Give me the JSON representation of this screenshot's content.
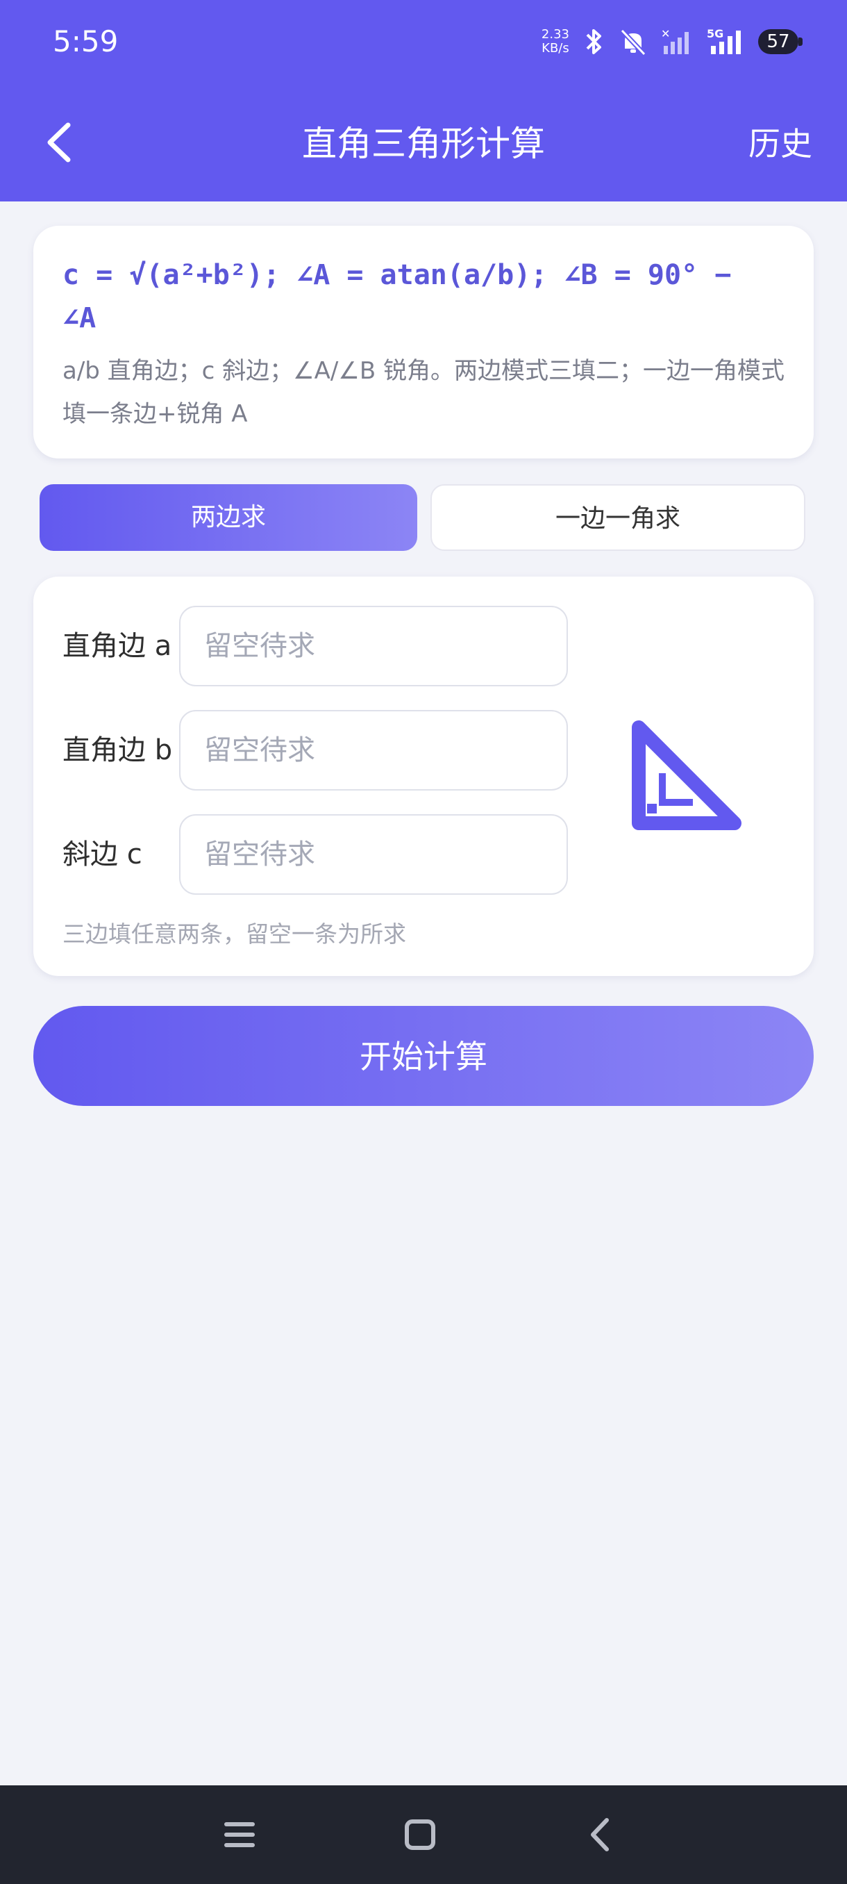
{
  "status_bar": {
    "time": "5:59",
    "net_speed_value": "2.33",
    "net_speed_unit": "KB/s",
    "network_label": "5G",
    "battery": "57",
    "icons": [
      "bluetooth-icon",
      "mute-icon",
      "signal-icon",
      "signal-5g-icon",
      "battery-icon"
    ]
  },
  "header": {
    "title": "直角三角形计算",
    "history_label": "历史",
    "back_icon": "chevron-left-icon"
  },
  "formula_card": {
    "formula_line1": "c = √(a²+b²); ∠A = atan(a/b); ∠B = 90° −",
    "formula_line2": "∠A",
    "description": "a/b 直角边；c 斜边；∠A/∠B 锐角。两边模式三填二；一边一角模式填一条边+锐角 A"
  },
  "mode_tabs": [
    {
      "label": "两边求",
      "active": true
    },
    {
      "label": "一边一角求",
      "active": false
    }
  ],
  "inputs": [
    {
      "label": "直角边 a",
      "value": "",
      "placeholder": "留空待求"
    },
    {
      "label": "直角边 b",
      "value": "",
      "placeholder": "留空待求"
    },
    {
      "label": "斜边 c",
      "value": "",
      "placeholder": "留空待求"
    }
  ],
  "hint": "三边填任意两条，留空一条为所求",
  "calculate_label": "开始计算",
  "nav_bar": {
    "icons": [
      "menu-icon",
      "home-icon",
      "back-icon"
    ]
  },
  "colors": {
    "primary": "#6259ef",
    "primary_light": "#8c85f5",
    "background": "#f2f3f9",
    "formula_text": "#5b57d8",
    "nav_bar": "#22252f"
  }
}
